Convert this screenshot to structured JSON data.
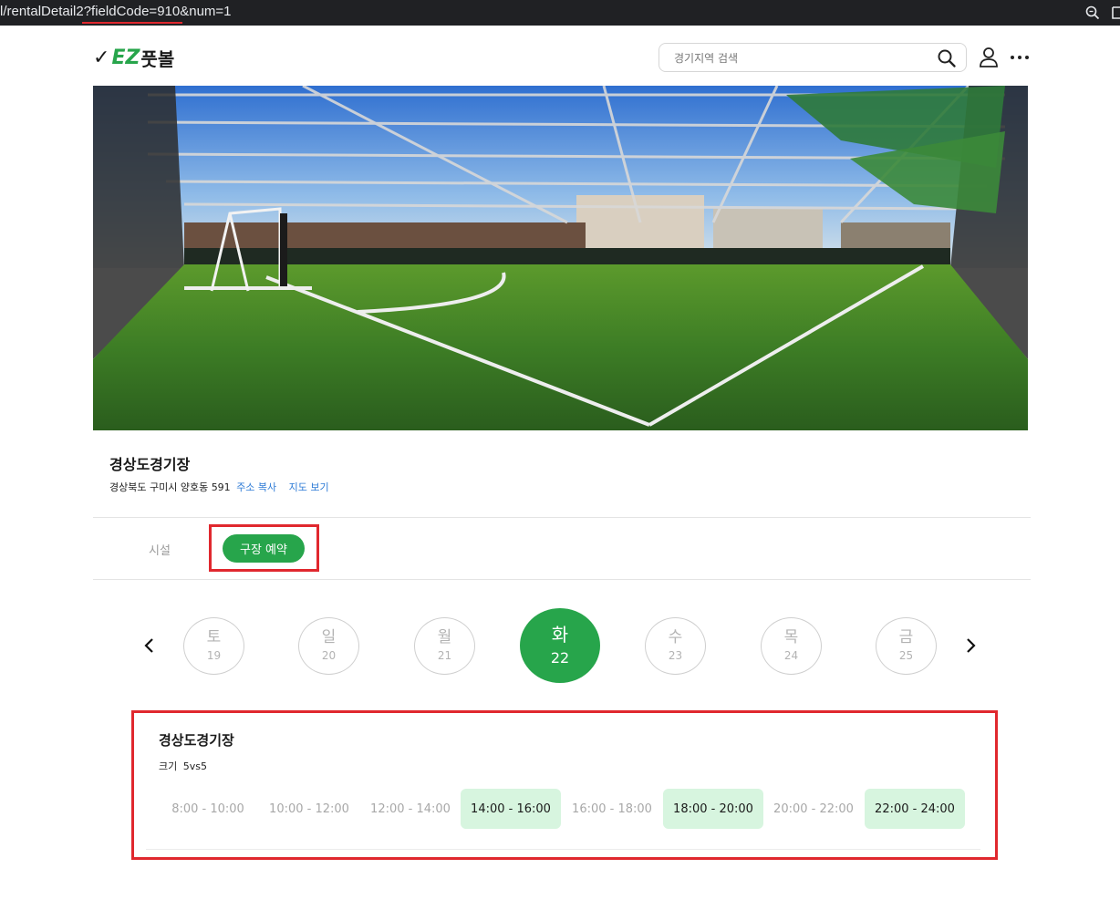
{
  "browser": {
    "url": "l/rentalDetail2?fieldCode=910&num=1",
    "zoom_icon": "zoom-icon"
  },
  "header": {
    "logo_text": "EZ풋볼",
    "logo_ez": "EZ",
    "logo_kr": "풋볼",
    "search_placeholder": "경기지역 검색",
    "icons": [
      "search-icon",
      "user-icon",
      "more-icon"
    ]
  },
  "hero": {
    "image": "futsal-field-photo"
  },
  "field": {
    "name": "경상도경기장",
    "address": "경상북도 구미시 양호동 591",
    "copy_link": "주소 복사",
    "map_link": "지도 보기"
  },
  "tabs": {
    "facility": "시설",
    "reserve": "구장 예약"
  },
  "dates": [
    {
      "dow": "토",
      "num": "19"
    },
    {
      "dow": "일",
      "num": "20"
    },
    {
      "dow": "월",
      "num": "21"
    },
    {
      "dow": "화",
      "num": "22",
      "active": true
    },
    {
      "dow": "수",
      "num": "23"
    },
    {
      "dow": "목",
      "num": "24"
    },
    {
      "dow": "금",
      "num": "25"
    }
  ],
  "card": {
    "title": "경상도경기장",
    "size_label": "크기",
    "size_value": "5vs5",
    "slots": [
      {
        "label": "8:00 - 10:00",
        "available": false
      },
      {
        "label": "10:00 - 12:00",
        "available": false
      },
      {
        "label": "12:00 - 14:00",
        "available": false
      },
      {
        "label": "14:00 - 16:00",
        "available": true
      },
      {
        "label": "16:00 - 18:00",
        "available": false
      },
      {
        "label": "18:00 - 20:00",
        "available": true
      },
      {
        "label": "20:00 - 22:00",
        "available": false
      },
      {
        "label": "22:00 - 24:00",
        "available": true
      }
    ]
  },
  "colors": {
    "brand_green": "#27a54b",
    "slot_available_bg": "#d7f5df",
    "annotation_red": "#e0282e",
    "link_blue": "#2d7bd6"
  }
}
